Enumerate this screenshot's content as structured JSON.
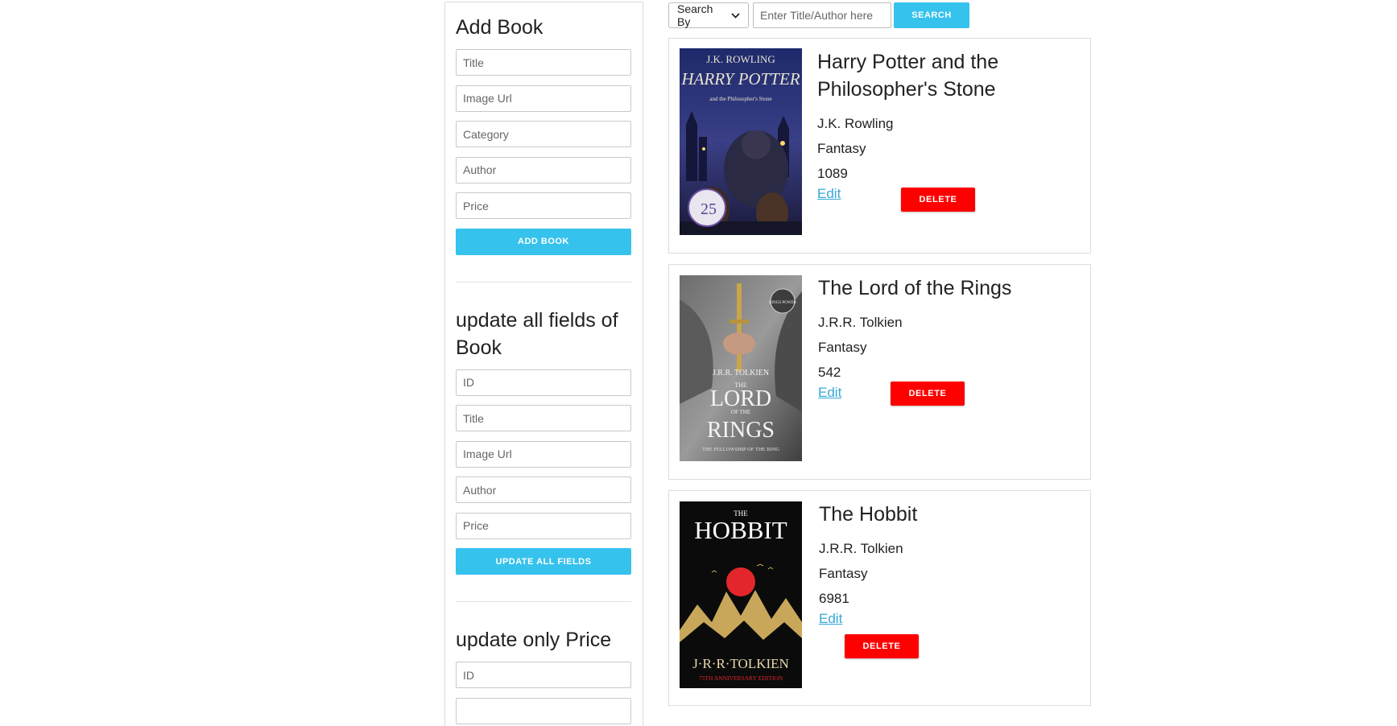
{
  "add_book": {
    "heading": "Add Book",
    "fields": {
      "title": "Title",
      "image_url": "Image Url",
      "category": "Category",
      "author": "Author",
      "price": "Price"
    },
    "button": "ADD BOOK"
  },
  "update_all": {
    "heading": "update all fields of Book",
    "fields": {
      "id": "ID",
      "title": "Title",
      "image_url": "Image Url",
      "author": "Author",
      "price": "Price"
    },
    "button": "UPDATE ALL FIELDS"
  },
  "update_price": {
    "heading": "update only Price",
    "fields": {
      "id": "ID"
    }
  },
  "search": {
    "select_label": "Search By",
    "placeholder": "Enter Title/Author here",
    "button": "SEARCH"
  },
  "books": [
    {
      "title": "Harry Potter and the Philosopher's Stone",
      "author": "J.K. Rowling",
      "category": "Fantasy",
      "price": "1089",
      "edit": "Edit",
      "delete": "DELETE",
      "cover": {
        "top_text": "J.K. ROWLING",
        "main_text": "HARRY POTTER",
        "sub_text": "and the Philosopher's Stone",
        "badge": "25"
      }
    },
    {
      "title": "The Lord of the Rings",
      "author": "J.R.R. Tolkien",
      "category": "Fantasy",
      "price": "542",
      "edit": "Edit",
      "delete": "DELETE",
      "cover": {
        "top_text": "J.R.R. TOLKIEN",
        "main_text": "LORD",
        "main_text_2": "RINGS",
        "small_text": "THE",
        "small_text_2": "OF THE",
        "sub_text": "THE FELLOWSHIP OF THE RING",
        "badge": "RINGS POWER"
      }
    },
    {
      "title": "The Hobbit",
      "author": "J.R.R. Tolkien",
      "category": "Fantasy",
      "price": "6981",
      "edit": "Edit",
      "delete": "DELETE",
      "cover": {
        "small_text": "THE",
        "main_text": "HOBBIT",
        "author_text": "J·R·R·TOLKIEN",
        "sub_text": "75TH ANNIVERSARY EDITION"
      }
    }
  ]
}
